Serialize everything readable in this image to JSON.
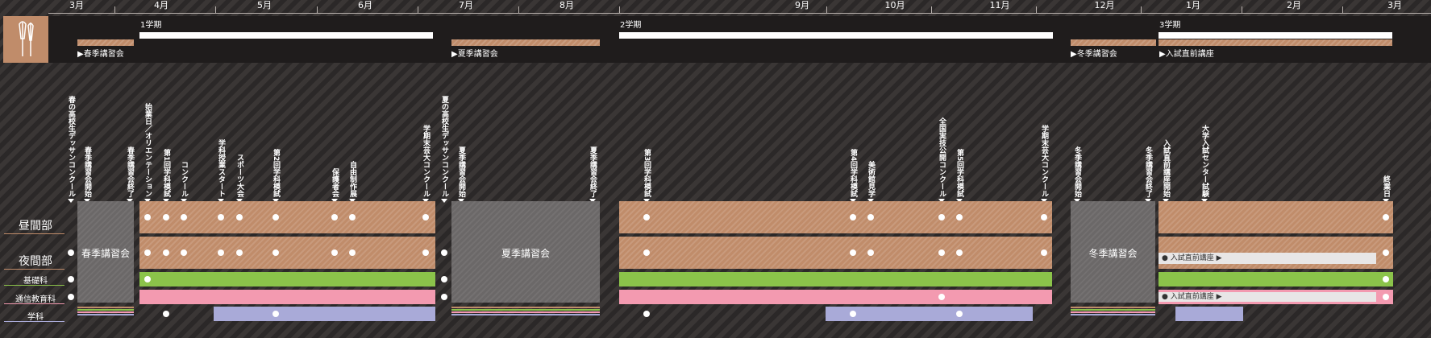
{
  "months": [
    "3月",
    "4月",
    "5月",
    "6月",
    "7月",
    "8月",
    "9月",
    "10月",
    "11月",
    "12月",
    "1月",
    "2月",
    "3月"
  ],
  "terms": {
    "term1": "1学期",
    "term2": "2学期",
    "term3": "3学期",
    "spring_course": "春季講習会",
    "summer_course": "夏季講習会",
    "winter_course": "冬季講習会",
    "entrance_course": "入試直前講座"
  },
  "rows": {
    "daytime": "昼間部",
    "evening": "夜間部",
    "basic": "基礎科",
    "correspondence": "通信教育科",
    "academic": "学科"
  },
  "gray_blocks": {
    "spring": "春季講習会",
    "summer": "夏季講習会",
    "winter": "冬季講習会"
  },
  "entrance_bars": {
    "evening": "入試直前講座",
    "correspondence": "入試直前講座"
  },
  "events": [
    "春の高校生デッサンコンクール",
    "春季講習会開始",
    "春季講習会終了",
    "始業日／オリエンテーション",
    "第1回学科模試",
    "コンクール",
    "学科授業スタート",
    "スポーツ大会",
    "第2回学科模試",
    "保護者会",
    "自由制作展",
    "学期末芸大コンクール",
    "夏の高校生デッサンコンクール",
    "夏季講習会開始",
    "夏季講習会終了",
    "第3回学科模試",
    "第4回学科模試",
    "美術館見学",
    "全国実技公開コンクール",
    "第5回学科模試",
    "学期末芸大コンクール",
    "冬季講習会開始",
    "冬季講習会終了",
    "入試直前講座開始",
    "大学入試センター試験",
    "終業日"
  ],
  "colors": {
    "tan": "#c08c6a",
    "green": "#8bc34a",
    "pink": "#f39ab0",
    "lavender": "#a9aad8",
    "gray": "#6b6868"
  }
}
